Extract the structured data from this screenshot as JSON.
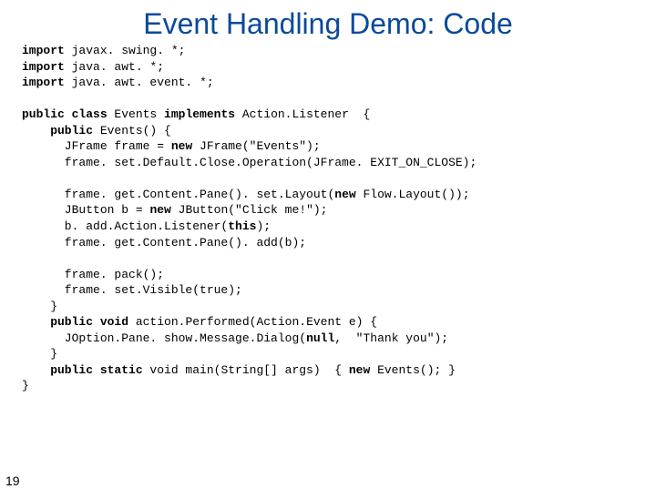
{
  "title": "Event Handling Demo: Code",
  "page_number": "19",
  "code": {
    "l1a": "import",
    "l1b": " javax. swing. *;",
    "l2a": "import",
    "l2b": " java. awt. *;",
    "l3a": "import",
    "l3b": " java. awt. event. *;",
    "l4": "",
    "l5a": "public class",
    "l5b": " Events ",
    "l5c": "implements",
    "l5d": " Action.Listener  {",
    "l6a": "    public",
    "l6b": " Events() {",
    "l7a": "      JFrame frame = ",
    "l7b": "new",
    "l7c": " JFrame(\"Events\");",
    "l8": "      frame. set.Default.Close.Operation(JFrame. EXIT_ON_CLOSE);",
    "l9": "",
    "l10a": "      frame. get.Content.Pane(). set.Layout(",
    "l10b": "new",
    "l10c": " Flow.Layout());",
    "l11a": "      JButton b = ",
    "l11b": "new",
    "l11c": " JButton(\"Click me!\");",
    "l12a": "      b. add.Action.Listener(",
    "l12b": "this",
    "l12c": ");",
    "l13": "      frame. get.Content.Pane(). add(b);",
    "l14": "",
    "l15": "      frame. pack();",
    "l16": "      frame. set.Visible(true);",
    "l17": "    }",
    "l18a": "    public void",
    "l18b": " action.Performed(Action.Event e) {",
    "l19a": "      JOption.Pane. show.Message.Dialog(",
    "l19b": "null",
    "l19c": ",  \"Thank you\");",
    "l20": "    }",
    "l21a": "    public static",
    "l21b": " void main(String[] args)  { ",
    "l21c": "new",
    "l21d": " Events(); }",
    "l22": "}"
  }
}
